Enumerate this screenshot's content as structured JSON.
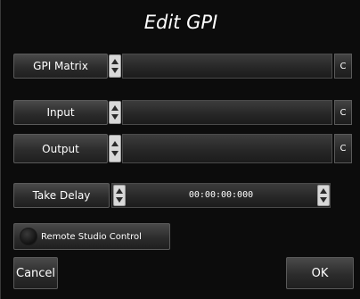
{
  "dialog": {
    "title": "Edit GPI"
  },
  "rows": {
    "gpi_matrix": {
      "label": "GPI Matrix",
      "value": "",
      "clear_label": "C"
    },
    "input": {
      "label": "Input",
      "value": "",
      "clear_label": "C"
    },
    "output": {
      "label": "Output",
      "value": "",
      "clear_label": "C"
    }
  },
  "take_delay": {
    "label": "Take Delay",
    "value": "00:00:00:000"
  },
  "remote_studio": {
    "label": "Remote Studio Control",
    "checked": false
  },
  "footer": {
    "cancel_label": "Cancel",
    "ok_label": "OK"
  }
}
